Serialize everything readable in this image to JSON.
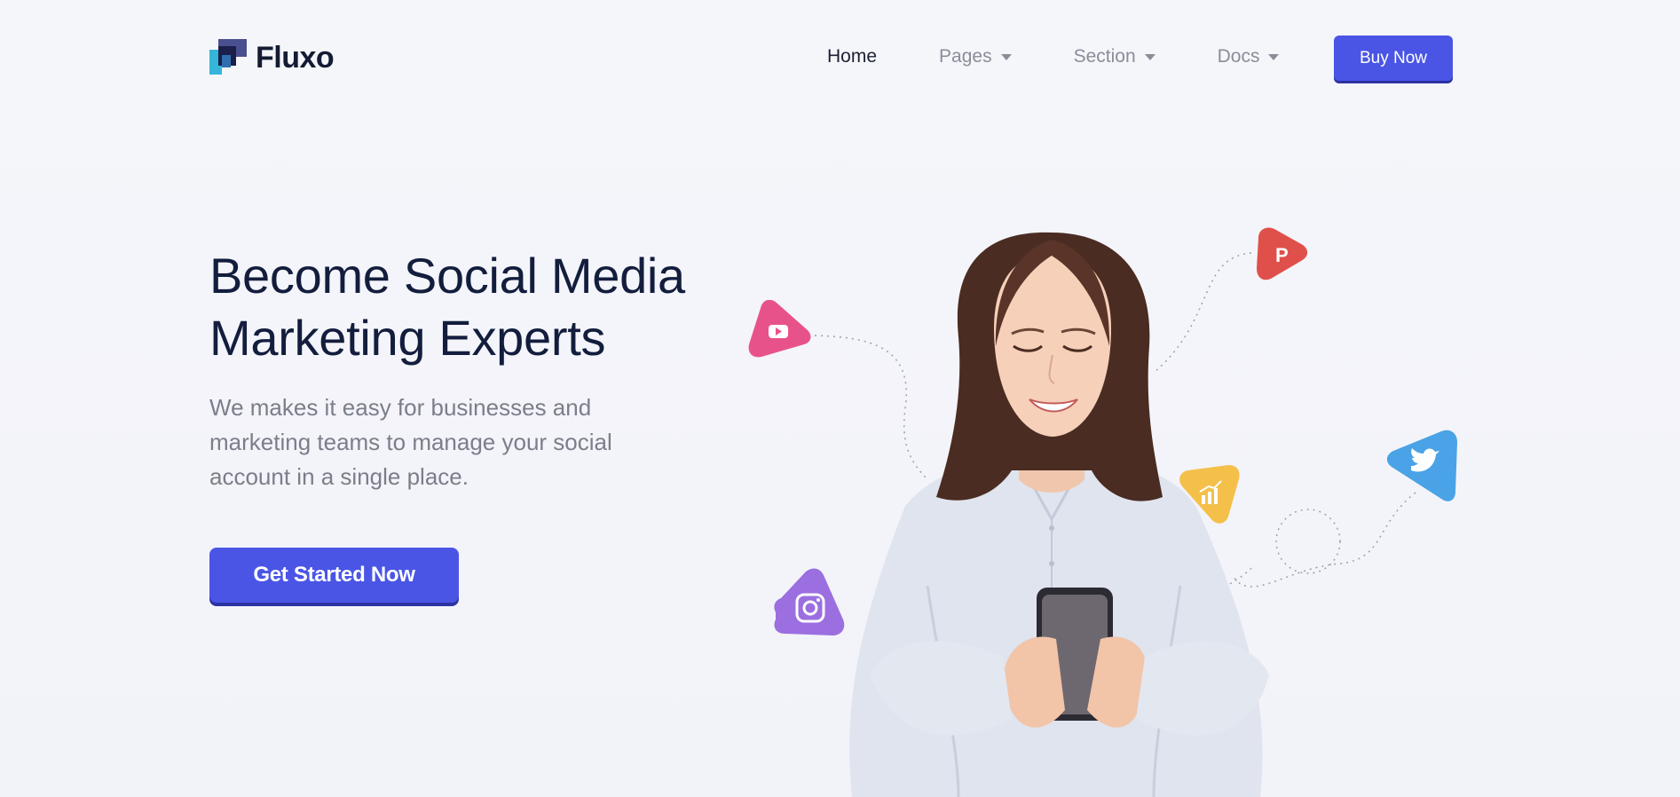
{
  "brand": {
    "name": "Fluxo"
  },
  "nav": {
    "items": [
      {
        "label": "Home",
        "active": true,
        "has_dropdown": false
      },
      {
        "label": "Pages",
        "active": false,
        "has_dropdown": true
      },
      {
        "label": "Section",
        "active": false,
        "has_dropdown": true
      },
      {
        "label": "Docs",
        "active": false,
        "has_dropdown": true
      }
    ],
    "buy_label": "Buy Now"
  },
  "hero": {
    "title_line1": "Become Social Media",
    "title_line2": "Marketing Experts",
    "desc_line1": "We makes it easy for businesses and",
    "desc_line2": "marketing teams to manage your social",
    "desc_line3": "account in a single place.",
    "cta_label": "Get Started Now"
  },
  "illustration": {
    "icons": [
      "youtube-icon",
      "pinterest-icon",
      "analytics-icon",
      "twitter-icon",
      "instagram-icon"
    ]
  },
  "colors": {
    "accent": "#4a55e6",
    "youtube": "#e8528a",
    "pinterest": "#e0504a",
    "analytics": "#f4c04a",
    "twitter": "#4aa3e6",
    "instagram": "#9b6fe0",
    "heading": "#131d3d"
  }
}
